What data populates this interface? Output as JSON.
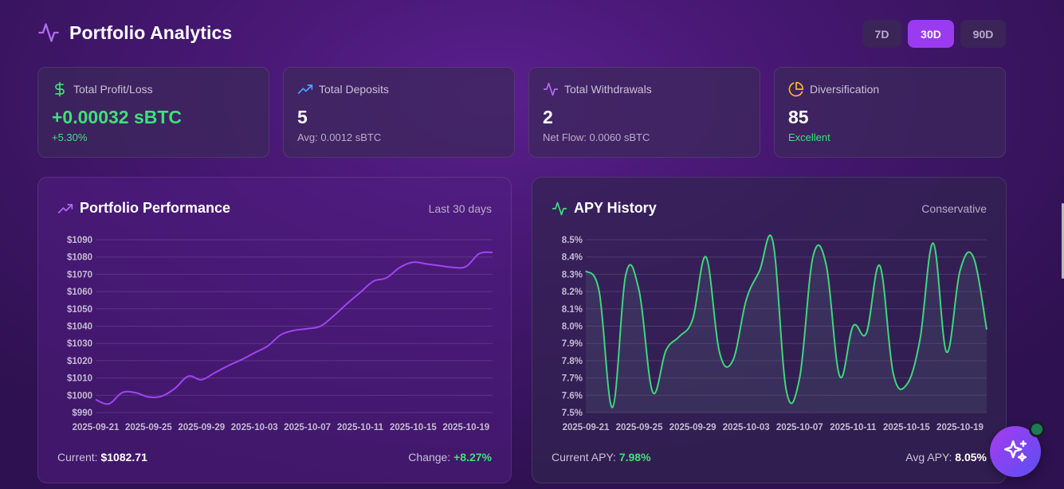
{
  "header": {
    "title": "Portfolio Analytics",
    "icon": "activity-icon"
  },
  "range": {
    "options": [
      "7D",
      "30D",
      "90D"
    ],
    "selected": "30D"
  },
  "stats": [
    {
      "label": "Total Profit/Loss",
      "value": "+0.00032 sBTC",
      "sub": "+5.30%",
      "icon": "dollar-icon",
      "icon_color": "#3ee07a"
    },
    {
      "label": "Total Deposits",
      "value": "5",
      "sub": "Avg: 0.0012 sBTC",
      "icon": "trending-up-icon",
      "icon_color": "#4aa3ff"
    },
    {
      "label": "Total Withdrawals",
      "value": "2",
      "sub": "Net Flow: 0.0060 sBTC",
      "icon": "activity-icon",
      "icon_color": "#b06cf0"
    },
    {
      "label": "Diversification",
      "value": "85",
      "sub": "Excellent",
      "icon": "pie-chart-icon",
      "icon_color": "#f5b82e"
    }
  ],
  "performance": {
    "title": "Portfolio Performance",
    "meta": "Last 30 days",
    "current_label": "Current:",
    "current_value": "$1082.71",
    "change_label": "Change:",
    "change_value": "+8.27%"
  },
  "apy": {
    "title": "APY History",
    "meta": "Conservative",
    "current_label": "Current APY:",
    "current_value": "7.98%",
    "avg_label": "Avg APY:",
    "avg_value": "8.05%"
  },
  "chart_data": [
    {
      "type": "line",
      "title": "Portfolio Performance",
      "x_ticks": [
        "2025-09-21",
        "2025-09-25",
        "2025-09-29",
        "2025-10-03",
        "2025-10-07",
        "2025-10-11",
        "2025-10-15",
        "2025-10-19"
      ],
      "y_ticks": [
        "$1090",
        "$1080",
        "$1070",
        "$1060",
        "$1050",
        "$1040",
        "$1030",
        "$1020",
        "$1010",
        "$1000",
        "$990"
      ],
      "ylim": [
        990,
        1090
      ],
      "color": "#a044f2",
      "series": [
        {
          "x": [
            "2025-09-21",
            "2025-09-22",
            "2025-09-23",
            "2025-09-24",
            "2025-09-25",
            "2025-09-26",
            "2025-09-27",
            "2025-09-28",
            "2025-09-29",
            "2025-09-30",
            "2025-10-01",
            "2025-10-02",
            "2025-10-03",
            "2025-10-04",
            "2025-10-05",
            "2025-10-06",
            "2025-10-07",
            "2025-10-08",
            "2025-10-09",
            "2025-10-10",
            "2025-10-11",
            "2025-10-12",
            "2025-10-13",
            "2025-10-14",
            "2025-10-15",
            "2025-10-16",
            "2025-10-17",
            "2025-10-18",
            "2025-10-19",
            "2025-10-20",
            "2025-10-21"
          ],
          "values": [
            997.5,
            995,
            1001.5,
            1001.5,
            999,
            999.5,
            1004,
            1011,
            1009,
            1013,
            1017,
            1020.5,
            1024.5,
            1028.5,
            1035,
            1037.5,
            1038.5,
            1040,
            1046,
            1053,
            1059.5,
            1066,
            1068,
            1074,
            1077,
            1076,
            1075,
            1074,
            1074.5,
            1082,
            1082.71
          ]
        }
      ]
    },
    {
      "type": "area",
      "title": "APY History",
      "x_ticks": [
        "2025-09-21",
        "2025-09-25",
        "2025-09-29",
        "2025-10-03",
        "2025-10-07",
        "2025-10-11",
        "2025-10-15",
        "2025-10-19"
      ],
      "y_ticks": [
        "8.5%",
        "8.4%",
        "8.3%",
        "8.2%",
        "8.1%",
        "8.0%",
        "7.9%",
        "7.8%",
        "7.7%",
        "7.6%",
        "7.5%"
      ],
      "ylim": [
        7.5,
        8.5
      ],
      "color": "#3ed67a",
      "series": [
        {
          "x": [
            "2025-09-21",
            "2025-09-22",
            "2025-09-23",
            "2025-09-24",
            "2025-09-25",
            "2025-09-26",
            "2025-09-27",
            "2025-09-28",
            "2025-09-29",
            "2025-09-30",
            "2025-10-01",
            "2025-10-02",
            "2025-10-03",
            "2025-10-04",
            "2025-10-05",
            "2025-10-06",
            "2025-10-07",
            "2025-10-08",
            "2025-10-09",
            "2025-10-10",
            "2025-10-11",
            "2025-10-12",
            "2025-10-13",
            "2025-10-14",
            "2025-10-15",
            "2025-10-16",
            "2025-10-17",
            "2025-10-18",
            "2025-10-19",
            "2025-10-20",
            "2025-10-21"
          ],
          "values": [
            8.32,
            8.2,
            7.53,
            8.3,
            8.2,
            7.62,
            7.86,
            7.94,
            8.04,
            8.4,
            7.85,
            7.8,
            8.15,
            8.32,
            8.49,
            7.63,
            7.7,
            8.4,
            8.35,
            7.71,
            8.0,
            7.96,
            8.35,
            7.73,
            7.66,
            7.92,
            8.48,
            7.85,
            8.32,
            8.4,
            7.98
          ]
        }
      ]
    }
  ]
}
